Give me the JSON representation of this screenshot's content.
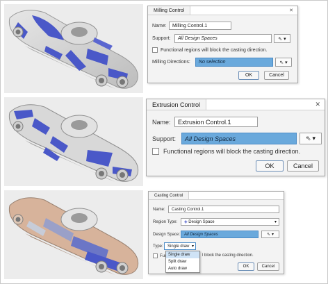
{
  "colors": {
    "accent_field": "#6aa9dc",
    "model_blue": "#4a58c8",
    "model_gray": "#d5d5d5",
    "model_tan": "#d7b39b"
  },
  "milling": {
    "title": "Milling Control",
    "name_label": "Name:",
    "name_value": "Milling Control.1",
    "support_label": "Support:",
    "support_value": "All Design Spaces",
    "functional_label": "Functional regions will block the casting direction.",
    "directions_label": "Milling Directions:",
    "directions_value": "No selection",
    "ok": "OK",
    "cancel": "Cancel",
    "close": "✕"
  },
  "extrusion": {
    "title": "Extrusion Control",
    "name_label": "Name:",
    "name_value": "Extrusion Control.1",
    "support_label": "Support:",
    "support_value": "All Design Spaces",
    "functional_label": "Functional regions will block the casting direction.",
    "ok": "OK",
    "cancel": "Cancel",
    "close": "✕"
  },
  "casting": {
    "title": "Casting Control",
    "name_label": "Name:",
    "name_value": "Casting Control.1",
    "region_label": "Region Type:",
    "region_value": "Design Space",
    "design_space_label": "Design Space:",
    "design_space_value": "All Design Spaces",
    "type_label": "Type:",
    "type_value": "Single draw",
    "functional_prefix": "Fun",
    "functional_suffix": "l block the casting direction.",
    "type_options": [
      "Single draw",
      "Split draw",
      "Auto draw"
    ],
    "ok": "OK",
    "cancel": "Cancel"
  }
}
